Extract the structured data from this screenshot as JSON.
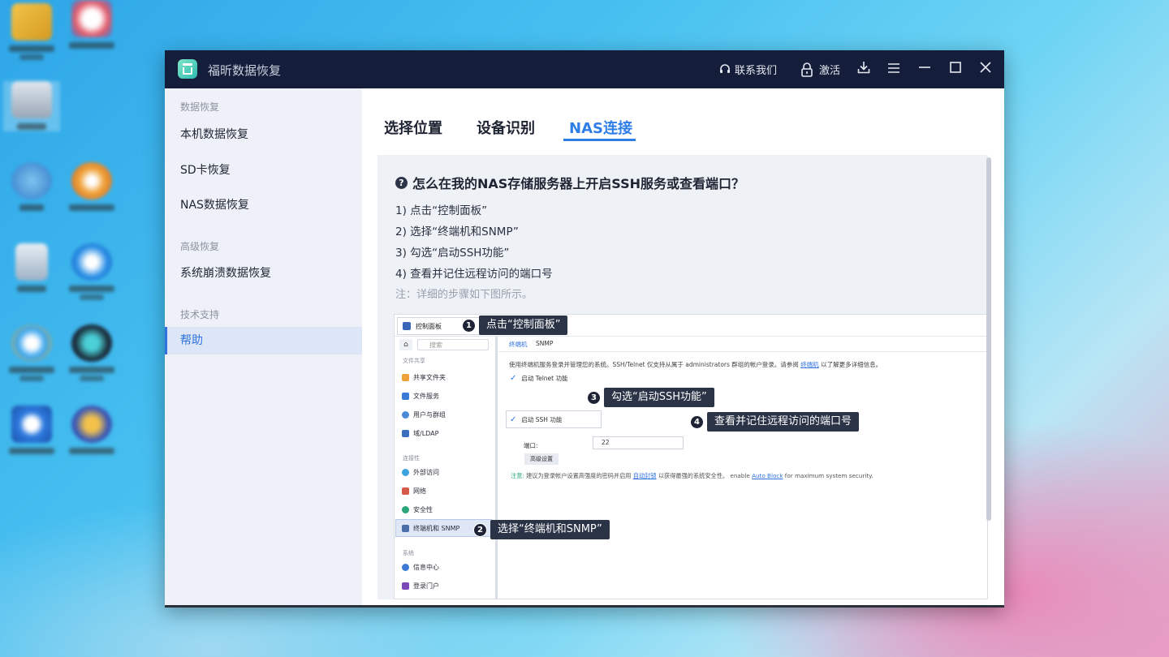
{
  "app": {
    "title": "福昕数据恢复",
    "contact_label": "联系我们",
    "activate_label": "激活",
    "icons": [
      "headset-icon",
      "lock-icon",
      "download-icon",
      "menu-icon",
      "minimize-icon",
      "maximize-icon",
      "close-icon"
    ]
  },
  "sidebar": {
    "groups": [
      {
        "label": "数据恢复",
        "items": [
          "本机数据恢复",
          "SD卡恢复",
          "NAS数据恢复"
        ]
      },
      {
        "label": "高级恢复",
        "items": [
          "系统崩溃数据恢复"
        ]
      },
      {
        "label": "技术支持",
        "items": [
          "帮助"
        ]
      }
    ],
    "active_item": "帮助"
  },
  "tabs": [
    {
      "label": "选择位置",
      "active": false
    },
    {
      "label": "设备识别",
      "active": false
    },
    {
      "label": "NAS连接",
      "active": true
    }
  ],
  "help": {
    "question": "怎么在我的NAS存储服务器上开启SSH服务或查看端口？",
    "steps": [
      "1) 点击“控制面板”",
      "2) 选择“终端机和SNMP”",
      "3) 勾选“启动SSH功能”",
      "4) 查看并记住远程访问的端口号"
    ],
    "note": "注：详细的步骤如下图所示。"
  },
  "screenshot": {
    "control_panel": "控制面板",
    "search_placeholder": "搜索",
    "side_groups": [
      "文件共享",
      "连接性",
      "系统"
    ],
    "side_items": [
      "共享文件夹",
      "文件服务",
      "用户与群组",
      "域/LDAP",
      "外部访问",
      "网络",
      "安全性",
      "终端机和 SNMP",
      "信息中心",
      "登录门户"
    ],
    "tabs": [
      "终端机",
      "SNMP"
    ],
    "description": "使用终端机服务登录并管理您的系统。SSH/Telnet 仅支持从属于 administrators 群组的帐户登录。请参阅",
    "description_link": "终端机",
    "description_tail": "以了解更多详细信息。",
    "telnet_label": "启动 Telnet 功能",
    "ssh_label": "启动 SSH 功能",
    "port_label": "端口:",
    "port_value": "22",
    "advanced_button": "高级设置",
    "note_prefix": "注意:",
    "note_text": "建议为登录帐户设置高强度的密码并启用",
    "note_link": "自动封锁",
    "note_text2": "以获得最强的系统安全性。",
    "note_en": "enable",
    "note_en_link": "Auto Block",
    "note_en_tail": "for maximum system security.",
    "callouts": [
      {
        "num": "1",
        "text": "点击“控制面板”"
      },
      {
        "num": "2",
        "text": "选择“终端机和SNMP”"
      },
      {
        "num": "3",
        "text": "勾选“启动SSH功能”"
      },
      {
        "num": "4",
        "text": "查看并记住远程访问的端口号"
      }
    ]
  },
  "colors": {
    "titlebar": "#141d3a",
    "accent": "#2f7ee8",
    "sidebar_bg": "#eef1f7",
    "content_bg": "#eef1f6"
  }
}
